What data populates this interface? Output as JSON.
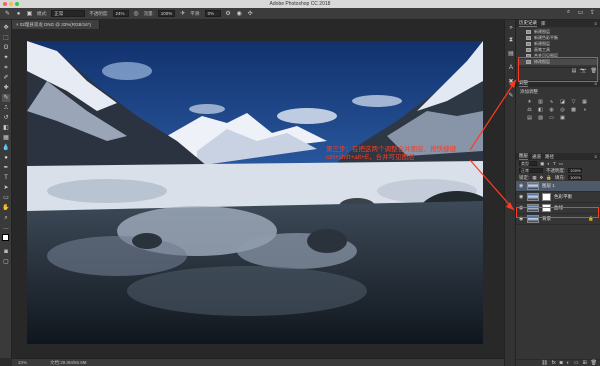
{
  "window": {
    "title": "Adobe Photoshop CC 2018",
    "traffic_colors": [
      "#fc605c",
      "#fdbc40",
      "#34c84a"
    ]
  },
  "options_bar": {
    "mode_label": "模式:",
    "mode_value": "正常",
    "opacity_label": "不透明度:",
    "opacity_value": "24%",
    "flow_label": "流量:",
    "flow_value": "100%",
    "smoothing_label": "平滑:",
    "smoothing_value": "0%"
  },
  "document": {
    "tab_label": "× 02理县双龙 DNG @ 33%(RGB/16*)"
  },
  "status_bar": {
    "zoom": "33%",
    "doc_info": "文档:39.8M/56.8M"
  },
  "history_panel": {
    "tabs": [
      "历史记录",
      "库"
    ],
    "items": [
      {
        "label": "新建图层"
      },
      {
        "label": "新建色彩平衡"
      },
      {
        "label": "新建图层"
      },
      {
        "label": "画笔工具"
      },
      {
        "label": "合并可见图层"
      },
      {
        "label": "修改图层"
      }
    ]
  },
  "adjustments_panel": {
    "tabs": [
      "调整"
    ],
    "add_label": "添加调整"
  },
  "layers_panel": {
    "tabs": [
      "图层",
      "通道",
      "路径"
    ],
    "kind_label": "类型",
    "blend_mode": "正常",
    "opacity_label": "不透明度:",
    "opacity_value": "100%",
    "lock_label": "锁定:",
    "fill_label": "填充:",
    "fill_value": "100%",
    "layers": [
      {
        "name": "图层 1",
        "selected": true
      },
      {
        "name": "色彩平衡",
        "has_mask": true
      },
      {
        "name": "曲线",
        "has_mask": true
      },
      {
        "name": "背景",
        "locked": true
      }
    ]
  },
  "annotation": {
    "text": "第三步：在把这两个调整合并图层，按快捷键ctrl+shift+alt+E，合并可见图层",
    "color": "#ff3b1f"
  }
}
